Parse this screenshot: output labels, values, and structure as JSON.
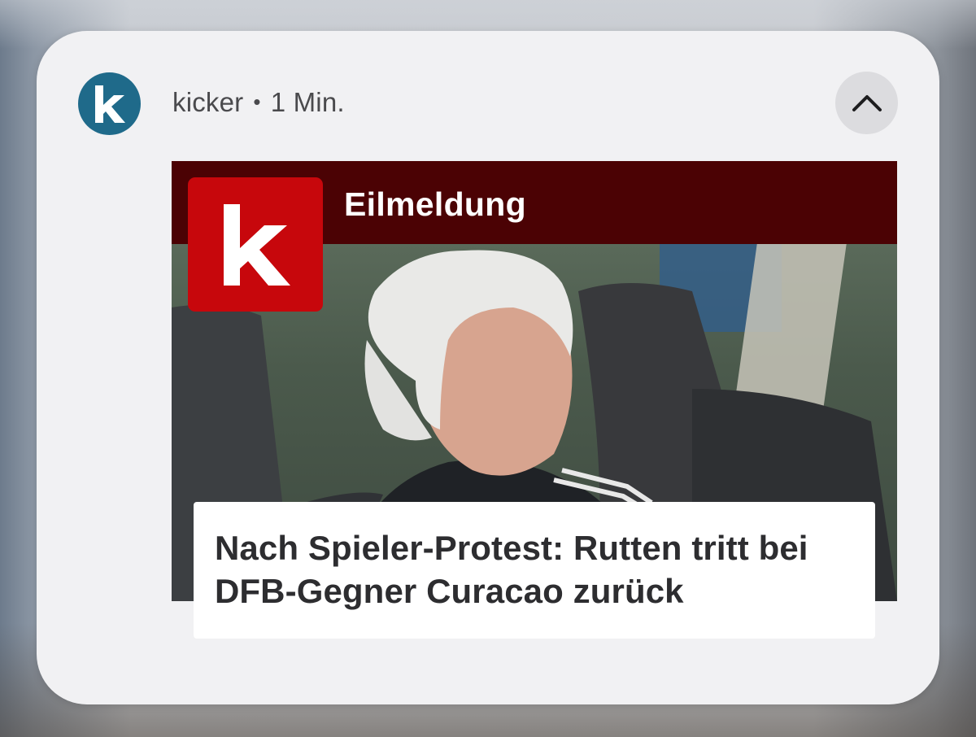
{
  "notification": {
    "app_name": "kicker",
    "separator": "•",
    "time": "1 Min.",
    "app_icon": "kicker-k-icon",
    "collapse_icon": "chevron-up-icon"
  },
  "card": {
    "banner_title": "Eilmeldung",
    "brand_logo": "kicker-logo",
    "headline": "Nach Spieler-Protest: Rutten tritt bei DFB-Gegner Curacao zurück"
  },
  "colors": {
    "app_icon_bg": "#1f6a8a",
    "banner_bg": "#4b0204",
    "logo_bg": "#c7070c",
    "card_bg": "#f1f1f3"
  }
}
